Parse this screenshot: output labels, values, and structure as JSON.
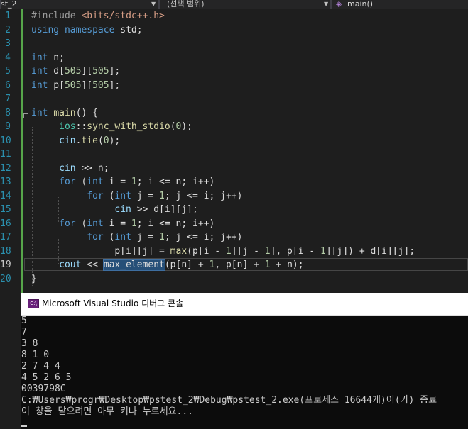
{
  "navbar": {
    "project": "st_2",
    "scope": "(선택 범위)",
    "function": "main()"
  },
  "editor": {
    "line_numbers": [
      "1",
      "2",
      "3",
      "4",
      "5",
      "6",
      "7",
      "8",
      "9",
      "10",
      "11",
      "12",
      "13",
      "14",
      "15",
      "16",
      "17",
      "18",
      "19",
      "20"
    ],
    "current_line": 19,
    "lines": [
      [
        [
          "pp",
          "#include "
        ],
        [
          "str",
          "<bits/stdc++.h>"
        ]
      ],
      [
        [
          "kw",
          "using"
        ],
        [
          "t",
          " "
        ],
        [
          "kw",
          "namespace"
        ],
        [
          "t",
          " std;"
        ]
      ],
      [],
      [
        [
          "kw",
          "int"
        ],
        [
          "t",
          " n;"
        ]
      ],
      [
        [
          "kw",
          "int"
        ],
        [
          "t",
          " d["
        ],
        [
          "num",
          "505"
        ],
        [
          "t",
          "]["
        ],
        [
          "num",
          "505"
        ],
        [
          "t",
          "];"
        ]
      ],
      [
        [
          "kw",
          "int"
        ],
        [
          "t",
          " p["
        ],
        [
          "num",
          "505"
        ],
        [
          "t",
          "]["
        ],
        [
          "num",
          "505"
        ],
        [
          "t",
          "];"
        ]
      ],
      [],
      [
        [
          "kw",
          "int"
        ],
        [
          "t",
          " "
        ],
        [
          "fn",
          "main"
        ],
        [
          "t",
          "() {"
        ]
      ],
      [
        [
          "t",
          "     "
        ],
        [
          "ns",
          "ios"
        ],
        [
          "t",
          "::"
        ],
        [
          "fn",
          "sync_with_stdio"
        ],
        [
          "t",
          "("
        ],
        [
          "num",
          "0"
        ],
        [
          "t",
          ");"
        ]
      ],
      [
        [
          "t",
          "     "
        ],
        [
          "var",
          "cin"
        ],
        [
          "t",
          "."
        ],
        [
          "fn",
          "tie"
        ],
        [
          "t",
          "("
        ],
        [
          "num",
          "0"
        ],
        [
          "t",
          ");"
        ]
      ],
      [],
      [
        [
          "t",
          "     "
        ],
        [
          "var",
          "cin"
        ],
        [
          "t",
          " >> n;"
        ]
      ],
      [
        [
          "t",
          "     "
        ],
        [
          "kw",
          "for"
        ],
        [
          "t",
          " ("
        ],
        [
          "kw",
          "int"
        ],
        [
          "t",
          " i = "
        ],
        [
          "num",
          "1"
        ],
        [
          "t",
          "; i <= n; i++)"
        ]
      ],
      [
        [
          "t",
          "          "
        ],
        [
          "kw",
          "for"
        ],
        [
          "t",
          " ("
        ],
        [
          "kw",
          "int"
        ],
        [
          "t",
          " j = "
        ],
        [
          "num",
          "1"
        ],
        [
          "t",
          "; j <= i; j++)"
        ]
      ],
      [
        [
          "t",
          "               "
        ],
        [
          "var",
          "cin"
        ],
        [
          "t",
          " >> d[i][j];"
        ]
      ],
      [
        [
          "t",
          "     "
        ],
        [
          "kw",
          "for"
        ],
        [
          "t",
          " ("
        ],
        [
          "kw",
          "int"
        ],
        [
          "t",
          " i = "
        ],
        [
          "num",
          "1"
        ],
        [
          "t",
          "; i <= n; i++)"
        ]
      ],
      [
        [
          "t",
          "          "
        ],
        [
          "kw",
          "for"
        ],
        [
          "t",
          " ("
        ],
        [
          "kw",
          "int"
        ],
        [
          "t",
          " j = "
        ],
        [
          "num",
          "1"
        ],
        [
          "t",
          "; j <= i; j++)"
        ]
      ],
      [
        [
          "t",
          "               p[i][j] = "
        ],
        [
          "fn",
          "max"
        ],
        [
          "t",
          "(p[i - "
        ],
        [
          "num",
          "1"
        ],
        [
          "t",
          "][j - "
        ],
        [
          "num",
          "1"
        ],
        [
          "t",
          "], p[i - "
        ],
        [
          "num",
          "1"
        ],
        [
          "t",
          "][j]) + d[i][j];"
        ]
      ],
      [
        [
          "t",
          "     "
        ],
        [
          "var",
          "cout"
        ],
        [
          "t",
          " << "
        ],
        [
          "hl",
          "max_element"
        ],
        [
          "t",
          "(p[n] + "
        ],
        [
          "num",
          "1"
        ],
        [
          "t",
          ", p[n] + "
        ],
        [
          "num",
          "1"
        ],
        [
          "t",
          " + n);"
        ]
      ],
      [
        [
          "t",
          "}"
        ]
      ]
    ]
  },
  "console": {
    "icon_text": "C:\\",
    "title": "Microsoft Visual Studio 디버그 콘솔",
    "lines": [
      "5",
      "7",
      "3 8",
      "8 1 0",
      "2 7 4 4",
      "4 5 2 6 5",
      "0039798C",
      "C:₩Users₩progr₩Desktop₩pstest_2₩Debug₩pstest_2.exe(프로세스 16644개)이(가) 종료",
      "이 창을 닫으려면 아무 키나 누르세요..."
    ]
  },
  "colors": {
    "keyword": "#569cd6",
    "string": "#d69d85",
    "function": "#dcdcaa",
    "number": "#b5cea8",
    "type_ns": "#4ec9b0",
    "variable": "#9cdcfe",
    "preprocessor": "#9b9b9b",
    "line_number": "#2b91af",
    "change_bar": "#57a64a",
    "selection": "#264f78"
  }
}
